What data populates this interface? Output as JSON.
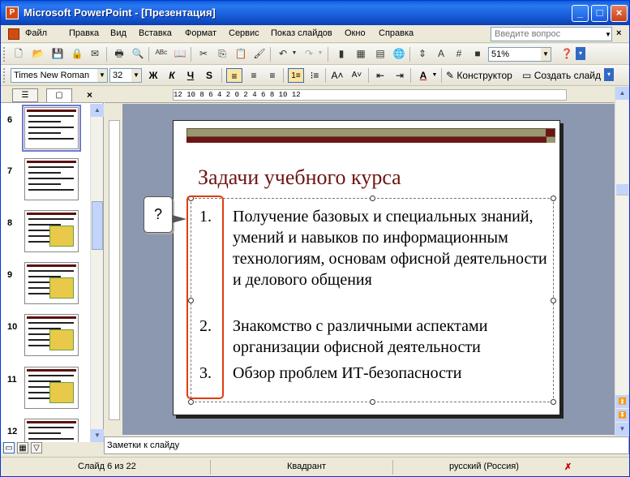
{
  "window": {
    "app_name": "Microsoft PowerPoint",
    "doc_name": "[Презентация]",
    "title": "Microsoft PowerPoint - [Презентация]"
  },
  "menu": {
    "items": [
      "Файл",
      "Правка",
      "Вид",
      "Вставка",
      "Формат",
      "Сервис",
      "Показ слайдов",
      "Окно",
      "Справка"
    ],
    "help_placeholder": "Введите вопрос"
  },
  "toolbar": {
    "zoom": "51%"
  },
  "formatting": {
    "font": "Times New Roman",
    "size": "32",
    "bold": "Ж",
    "italic": "К",
    "underline": "Ч",
    "shadow": "S",
    "designer": "Конструктор",
    "new_slide": "Создать слайд"
  },
  "ruler": {
    "labels": "12 10 8 6 4 2 0 2 4 6 8 10 12"
  },
  "thumbnails": [
    {
      "num": "6",
      "selected": true
    },
    {
      "num": "7",
      "selected": false
    },
    {
      "num": "8",
      "selected": false
    },
    {
      "num": "9",
      "selected": false
    },
    {
      "num": "10",
      "selected": false
    },
    {
      "num": "11",
      "selected": false
    },
    {
      "num": "12",
      "selected": false
    }
  ],
  "slide": {
    "title": "Задачи учебного курса",
    "items": [
      {
        "num": "1.",
        "text": "Получение базовых и специальных знаний, умений и навыков по информационным технологиям, основам офисной деятельности и делового общения"
      },
      {
        "num": "2.",
        "text": "Знакомство с различными аспектами организации офисной деятельности"
      },
      {
        "num": "3.",
        "text": "Обзор проблем ИТ-безопасности"
      }
    ]
  },
  "callout": {
    "text": "?"
  },
  "notes": {
    "placeholder": "Заметки к слайду"
  },
  "status": {
    "slide": "Слайд 6 из 22",
    "design": "Квадрант",
    "language": "русский (Россия)"
  }
}
